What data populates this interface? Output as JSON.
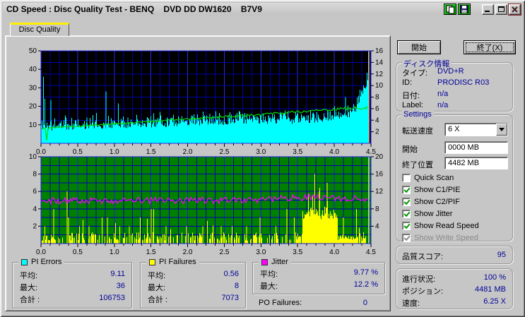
{
  "colors": {
    "value_text": "#000099",
    "group_title": "#000099",
    "checkmark": "#009900",
    "tab_stripe": "#ffee00"
  },
  "window": {
    "title": "CD Speed : Disc Quality Test - BENQ    DVD DD DW1620    B7V9"
  },
  "tab": {
    "label": "Disc Quality"
  },
  "buttons": {
    "start": "開始",
    "exit": "終了(X)"
  },
  "disc_info": {
    "title": "ディスク情報",
    "rows": [
      {
        "label": "タイプ:",
        "value": "DVD+R"
      },
      {
        "label": "ID:",
        "value": "PRODISC R03"
      },
      {
        "label": "日付:",
        "value": "n/a"
      },
      {
        "label": "Label:",
        "value": "n/a"
      }
    ]
  },
  "settings": {
    "title": "Settings",
    "speed_label": "転送速度",
    "speed_value": "6 X",
    "start_label": "開始",
    "start_value": "0000 MB",
    "end_label": "終了位置",
    "end_value": "4482 MB",
    "checkboxes": [
      {
        "label": "Quick Scan",
        "checked": false,
        "disabled": false
      },
      {
        "label": "Show C1/PIE",
        "checked": true,
        "disabled": false
      },
      {
        "label": "Show C2/PIF",
        "checked": true,
        "disabled": false
      },
      {
        "label": "Show Jitter",
        "checked": true,
        "disabled": false
      },
      {
        "label": "Show Read Speed",
        "checked": true,
        "disabled": false
      },
      {
        "label": "Show Write Speed",
        "checked": true,
        "disabled": true
      }
    ]
  },
  "quality": {
    "label": "品質スコア:",
    "value": "95"
  },
  "progress": {
    "rows": [
      {
        "label": "進行状況:",
        "value": "100 %"
      },
      {
        "label": "ポジション:",
        "value": "4481 MB"
      },
      {
        "label": "速度:",
        "value": "6.25 X"
      }
    ]
  },
  "stats": {
    "pi_errors": {
      "title": "PI Errors",
      "swatch": "#00ffff",
      "rows": [
        {
          "label": "平均:",
          "value": "9.11"
        },
        {
          "label": "最大:",
          "value": "36"
        },
        {
          "label": "合計 :",
          "value": "106753"
        }
      ]
    },
    "pi_failures": {
      "title": "PI Failures",
      "swatch": "#ffff00",
      "rows": [
        {
          "label": "平均:",
          "value": "0.56"
        },
        {
          "label": "最大:",
          "value": "8"
        },
        {
          "label": "合計 :",
          "value": "7073"
        }
      ]
    },
    "jitter": {
      "title": "Jitter",
      "swatch": "#ff00ff",
      "rows": [
        {
          "label": "平均:",
          "value": "9.77 %"
        },
        {
          "label": "最大:",
          "value": "12.2 %"
        }
      ]
    },
    "po_failures": {
      "label": "PO Failures:",
      "value": "0"
    }
  },
  "chart_data": [
    {
      "id": "pi_errors_read_speed",
      "type": "area",
      "title": "",
      "x_axis": {
        "min": 0,
        "max": 4.5,
        "major_step": 0.5,
        "minor_step": 0.125,
        "labels": [
          "0.0",
          "0.5",
          "1.0",
          "1.5",
          "2.0",
          "2.5",
          "3.0",
          "3.5",
          "4.0",
          "4.5"
        ]
      },
      "left_axis": {
        "min": 0,
        "max": 50,
        "ticks": [
          10,
          20,
          30,
          40,
          50
        ]
      },
      "right_axis": {
        "min": 0,
        "max": 16,
        "ticks": [
          2,
          4,
          6,
          8,
          10,
          12,
          14,
          16
        ]
      },
      "background": "#000000",
      "grid_minor": "#0000a8",
      "grid_major": "#2828f0",
      "h_rows": 8,
      "data_end_x": 4.46,
      "cursor_x": 4.47,
      "cursor_color": "#d4d4d4",
      "series": [
        {
          "name": "PI Errors",
          "render": "spiky-area",
          "axis": "left",
          "color": "#00ffff",
          "seed": 11,
          "baseline": [
            [
              0,
              9.0
            ],
            [
              0.1,
              8.3
            ],
            [
              0.5,
              8.8
            ],
            [
              1.0,
              9.5
            ],
            [
              1.5,
              10.2
            ],
            [
              2.0,
              10.8
            ],
            [
              2.5,
              11.3
            ],
            [
              3.0,
              11.8
            ],
            [
              3.5,
              12.2
            ],
            [
              3.9,
              12.6
            ],
            [
              4.1,
              14.0
            ],
            [
              4.27,
              17.0
            ],
            [
              4.38,
              27.0
            ],
            [
              4.46,
              34.0
            ]
          ],
          "noise_up": 5.0,
          "spike_prob": 0.04,
          "spike_extra": 4.0,
          "spikes": [
            [
              0.03,
              36
            ],
            [
              0.05,
              24
            ],
            [
              0.13,
              23.5
            ],
            [
              0.33,
              15
            ],
            [
              0.5,
              13
            ],
            [
              0.62,
              14
            ],
            [
              0.75,
              16.5
            ],
            [
              0.88,
              28
            ],
            [
              1.05,
              21.5
            ],
            [
              1.18,
              14
            ],
            [
              1.3,
              15.5
            ],
            [
              1.45,
              14
            ],
            [
              1.62,
              17
            ],
            [
              1.8,
              15
            ],
            [
              2.05,
              15
            ],
            [
              2.3,
              16
            ],
            [
              2.55,
              15
            ],
            [
              2.75,
              15.5
            ],
            [
              3.1,
              15
            ],
            [
              3.3,
              16.5
            ],
            [
              3.55,
              15
            ],
            [
              3.7,
              16
            ],
            [
              4.0,
              20
            ],
            [
              4.15,
              25
            ]
          ],
          "summary": {
            "average": 9.11,
            "maximum": 36,
            "total": 106753
          }
        },
        {
          "name": "Read Speed",
          "render": "line",
          "axis": "right",
          "color": "#00dd00",
          "seed": 12,
          "width": 1.2,
          "anchors": [
            [
              0,
              2.56
            ],
            [
              4.46,
              6.25
            ]
          ],
          "noise_base": 0.07,
          "noise_grow": 0.045,
          "dip": [
            0.08,
            0.5
          ],
          "final_speed": 6.25
        }
      ]
    },
    {
      "id": "pi_failures_jitter",
      "type": "bar",
      "title": "",
      "x_axis": {
        "min": 0,
        "max": 4.5,
        "major_step": 0.5,
        "minor_step": 0.125,
        "labels": [
          "0.0",
          "0.5",
          "1.0",
          "1.5",
          "2.0",
          "2.5",
          "3.0",
          "3.5",
          "4.0",
          "4.5"
        ]
      },
      "left_axis": {
        "min": 0,
        "max": 10,
        "ticks": [
          2,
          4,
          6,
          8,
          10
        ]
      },
      "right_axis": {
        "min": 0,
        "max": 20,
        "ticks": [
          4,
          8,
          12,
          16,
          20
        ]
      },
      "background": "#008000",
      "grid_minor": "#0000b4",
      "grid_major": "#2020e0",
      "h_rows": 10,
      "data_end_x": 4.46,
      "cursor_x": 4.47,
      "cursor_color": "#d4d4d4",
      "series": [
        {
          "name": "PI Failures",
          "render": "bars",
          "axis": "left",
          "color": "#ffff00",
          "seed": 13,
          "base_prob": 0.45,
          "base_h": 1.0,
          "tall_prob": 0.03,
          "tall_h": 1.5,
          "clusters": [
            {
              "from": 3.56,
              "to": 4.04,
              "min": 2.8,
              "max": 4.2,
              "spike_prob": 0.07,
              "spike_h": 3.0
            },
            {
              "from": 4.04,
              "to": 4.32,
              "min": 0.4,
              "max": 1.0,
              "spike_prob": 0.06,
              "spike_h": 1.6
            }
          ],
          "spikes": [
            [
              0.05,
              2
            ],
            [
              0.17,
              4
            ],
            [
              0.35,
              6
            ],
            [
              0.37,
              3
            ],
            [
              0.52,
              2
            ],
            [
              0.65,
              2
            ],
            [
              0.83,
              3
            ],
            [
              0.9,
              3
            ],
            [
              1.07,
              2
            ],
            [
              1.2,
              2
            ],
            [
              1.35,
              3
            ],
            [
              1.5,
              4
            ],
            [
              1.53,
              4
            ],
            [
              1.7,
              2
            ],
            [
              1.98,
              2
            ],
            [
              2.2,
              2
            ],
            [
              2.45,
              2
            ],
            [
              2.6,
              2
            ],
            [
              2.8,
              2
            ],
            [
              2.98,
              3
            ],
            [
              3.2,
              2
            ],
            [
              3.35,
              4
            ],
            [
              3.45,
              3
            ],
            [
              3.73,
              8
            ],
            [
              3.79,
              6
            ],
            [
              3.9,
              7
            ],
            [
              4.12,
              3
            ],
            [
              4.3,
              4
            ]
          ],
          "summary": {
            "average": 0.56,
            "maximum": 8,
            "total": 7073
          }
        },
        {
          "name": "Jitter",
          "render": "line",
          "axis": "right",
          "color": "#ff00ff",
          "seed": 14,
          "width": 1.2,
          "anchors": [
            [
              0,
              9.9
            ],
            [
              3.0,
              10.0
            ],
            [
              3.4,
              10.6
            ],
            [
              3.8,
              10.7
            ],
            [
              4.1,
              10.5
            ],
            [
              4.46,
              10.2
            ]
          ],
          "noise_base": 0.75,
          "noise_grow": 0,
          "clamp_max": 12.2,
          "summary": {
            "average": "9.77 %",
            "maximum": "12.2 %"
          }
        }
      ]
    }
  ]
}
